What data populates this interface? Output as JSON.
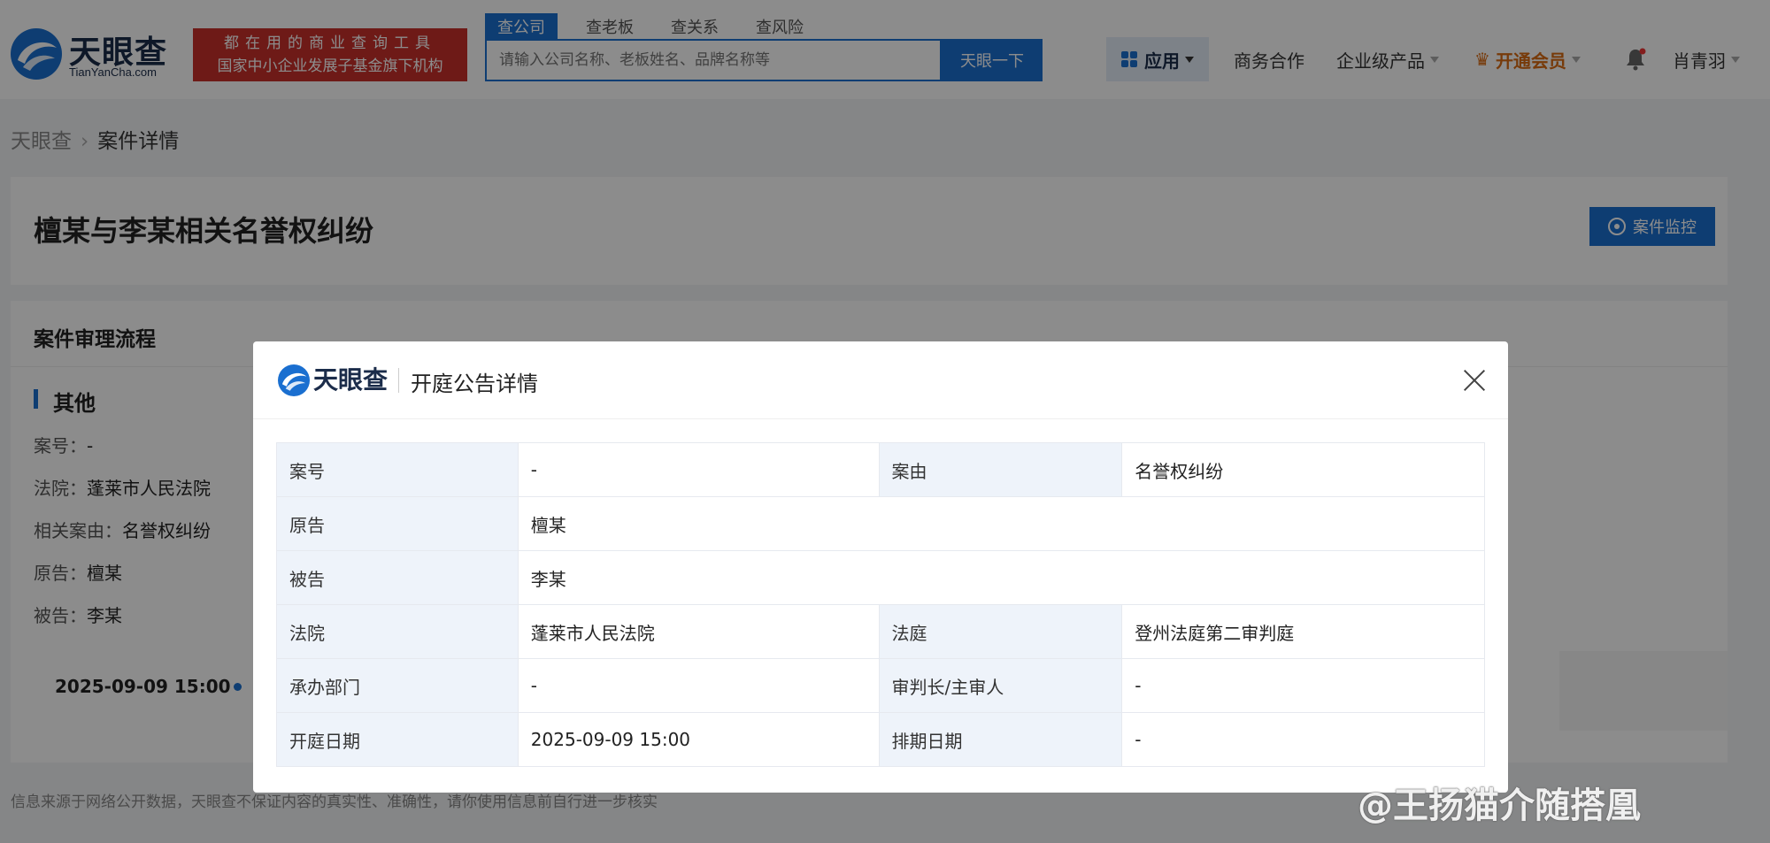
{
  "header": {
    "logo_text": "天眼查",
    "logo_sub": "TianYanCha.com",
    "promo_line1": "都在用的商业查询工具",
    "promo_line2": "国家中小企业发展子基金旗下机构",
    "search_tabs": [
      "查公司",
      "查老板",
      "查关系",
      "查风险"
    ],
    "search_placeholder": "请输入公司名称、老板姓名、品牌名称等",
    "search_button": "天眼一下",
    "nav": {
      "app": "应用",
      "business": "商务合作",
      "enterprise": "企业级产品",
      "vip": "开通会员",
      "user": "肖青羽"
    }
  },
  "breadcrumb": {
    "home": "天眼查",
    "current": "案件详情"
  },
  "case": {
    "title": "檀某与李某相关名誉权纠纷",
    "monitor_button": "案件监控"
  },
  "flow": {
    "title": "案件审理流程",
    "section": "其他",
    "fields": [
      {
        "label": "案号：",
        "value": "-"
      },
      {
        "label": "法院：",
        "value": "蓬莱市人民法院"
      },
      {
        "label": "相关案由：",
        "value": "名誉权纠纷"
      },
      {
        "label": "原告：",
        "value": "檀某"
      },
      {
        "label": "被告：",
        "value": "李某"
      }
    ],
    "timeline_date": "2025-09-09 15:00"
  },
  "footer_note": "信息来源于网络公开数据，天眼查不保证内容的真实性、准确性，请你使用信息前自行进一步核实",
  "modal": {
    "logo_text": "天眼查",
    "title": "开庭公告详情",
    "rows": [
      {
        "k1": "案号",
        "v1": "-",
        "k2": "案由",
        "v2": "名誉权纠纷"
      },
      {
        "k1": "原告",
        "v1": "檀某"
      },
      {
        "k1": "被告",
        "v1": "李某"
      },
      {
        "k1": "法院",
        "v1": "蓬莱市人民法院",
        "k2": "法庭",
        "v2": "登州法庭第二审判庭"
      },
      {
        "k1": "承办部门",
        "v1": "-",
        "k2": "审判长/主审人",
        "v2": "-"
      },
      {
        "k1": "开庭日期",
        "v1": "2025-09-09 15:00",
        "k2": "排期日期",
        "v2": "-"
      }
    ]
  },
  "watermark": "@王扬猫介随搭凰",
  "colors": {
    "brand_blue": "#1a6fd0",
    "promo_red": "#c8302a",
    "vip_orange": "#d96a12"
  }
}
